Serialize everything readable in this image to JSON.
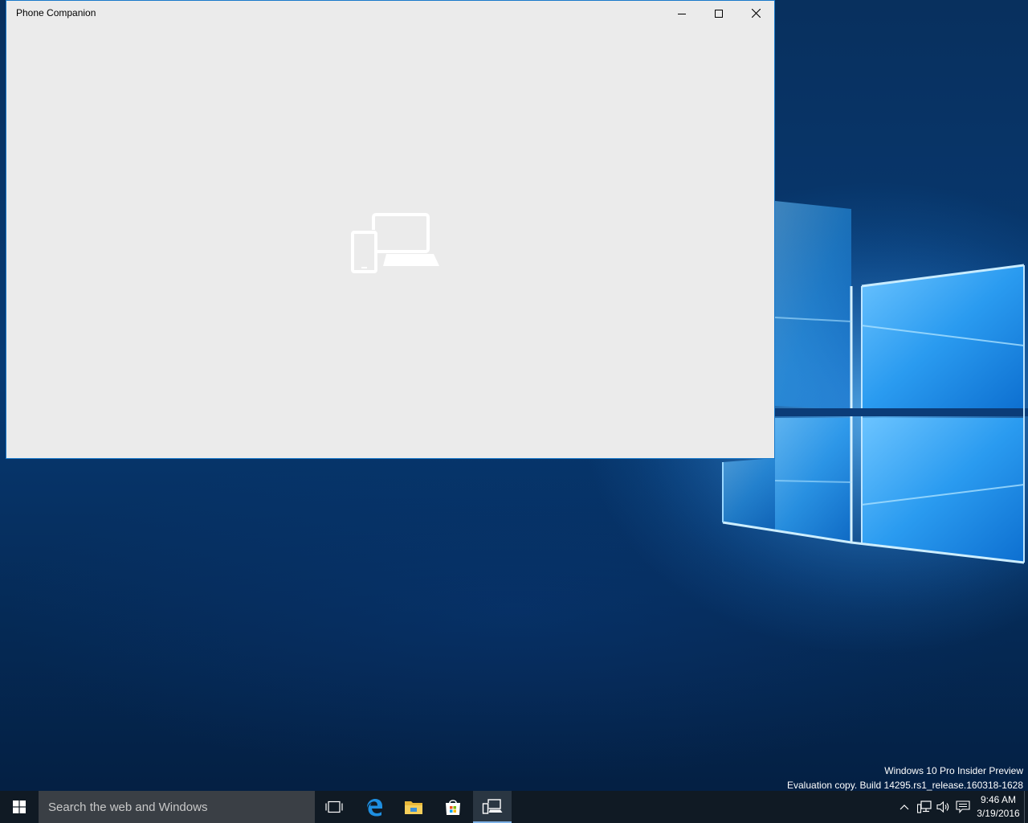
{
  "window": {
    "title": "Phone Companion",
    "minimize_icon": "minimize-icon",
    "maximize_icon": "maximize-icon",
    "close_icon": "close-icon",
    "splash_icon": "phone-laptop-icon",
    "background_color": "#ebebeb",
    "border_color": "#1979ca"
  },
  "watermark": {
    "line1": "Windows 10 Pro Insider Preview",
    "line2": "Evaluation copy. Build 14295.rs1_release.160318-1628"
  },
  "taskbar": {
    "start_icon": "windows-logo-icon",
    "search_placeholder": "Search the web and Windows",
    "apps": [
      {
        "name": "Task View",
        "icon": "task-view-icon"
      },
      {
        "name": "Microsoft Edge",
        "icon": "edge-icon"
      },
      {
        "name": "File Explorer",
        "icon": "folder-icon"
      },
      {
        "name": "Store",
        "icon": "store-icon"
      },
      {
        "name": "Phone Companion",
        "icon": "phone-companion-icon",
        "active": true
      }
    ],
    "tray": {
      "icons": [
        "chevron-up-icon",
        "network-icon",
        "volume-icon",
        "action-center-icon"
      ],
      "time": "9:46 AM",
      "date": "3/19/2016"
    },
    "background_color": "#101a24"
  }
}
